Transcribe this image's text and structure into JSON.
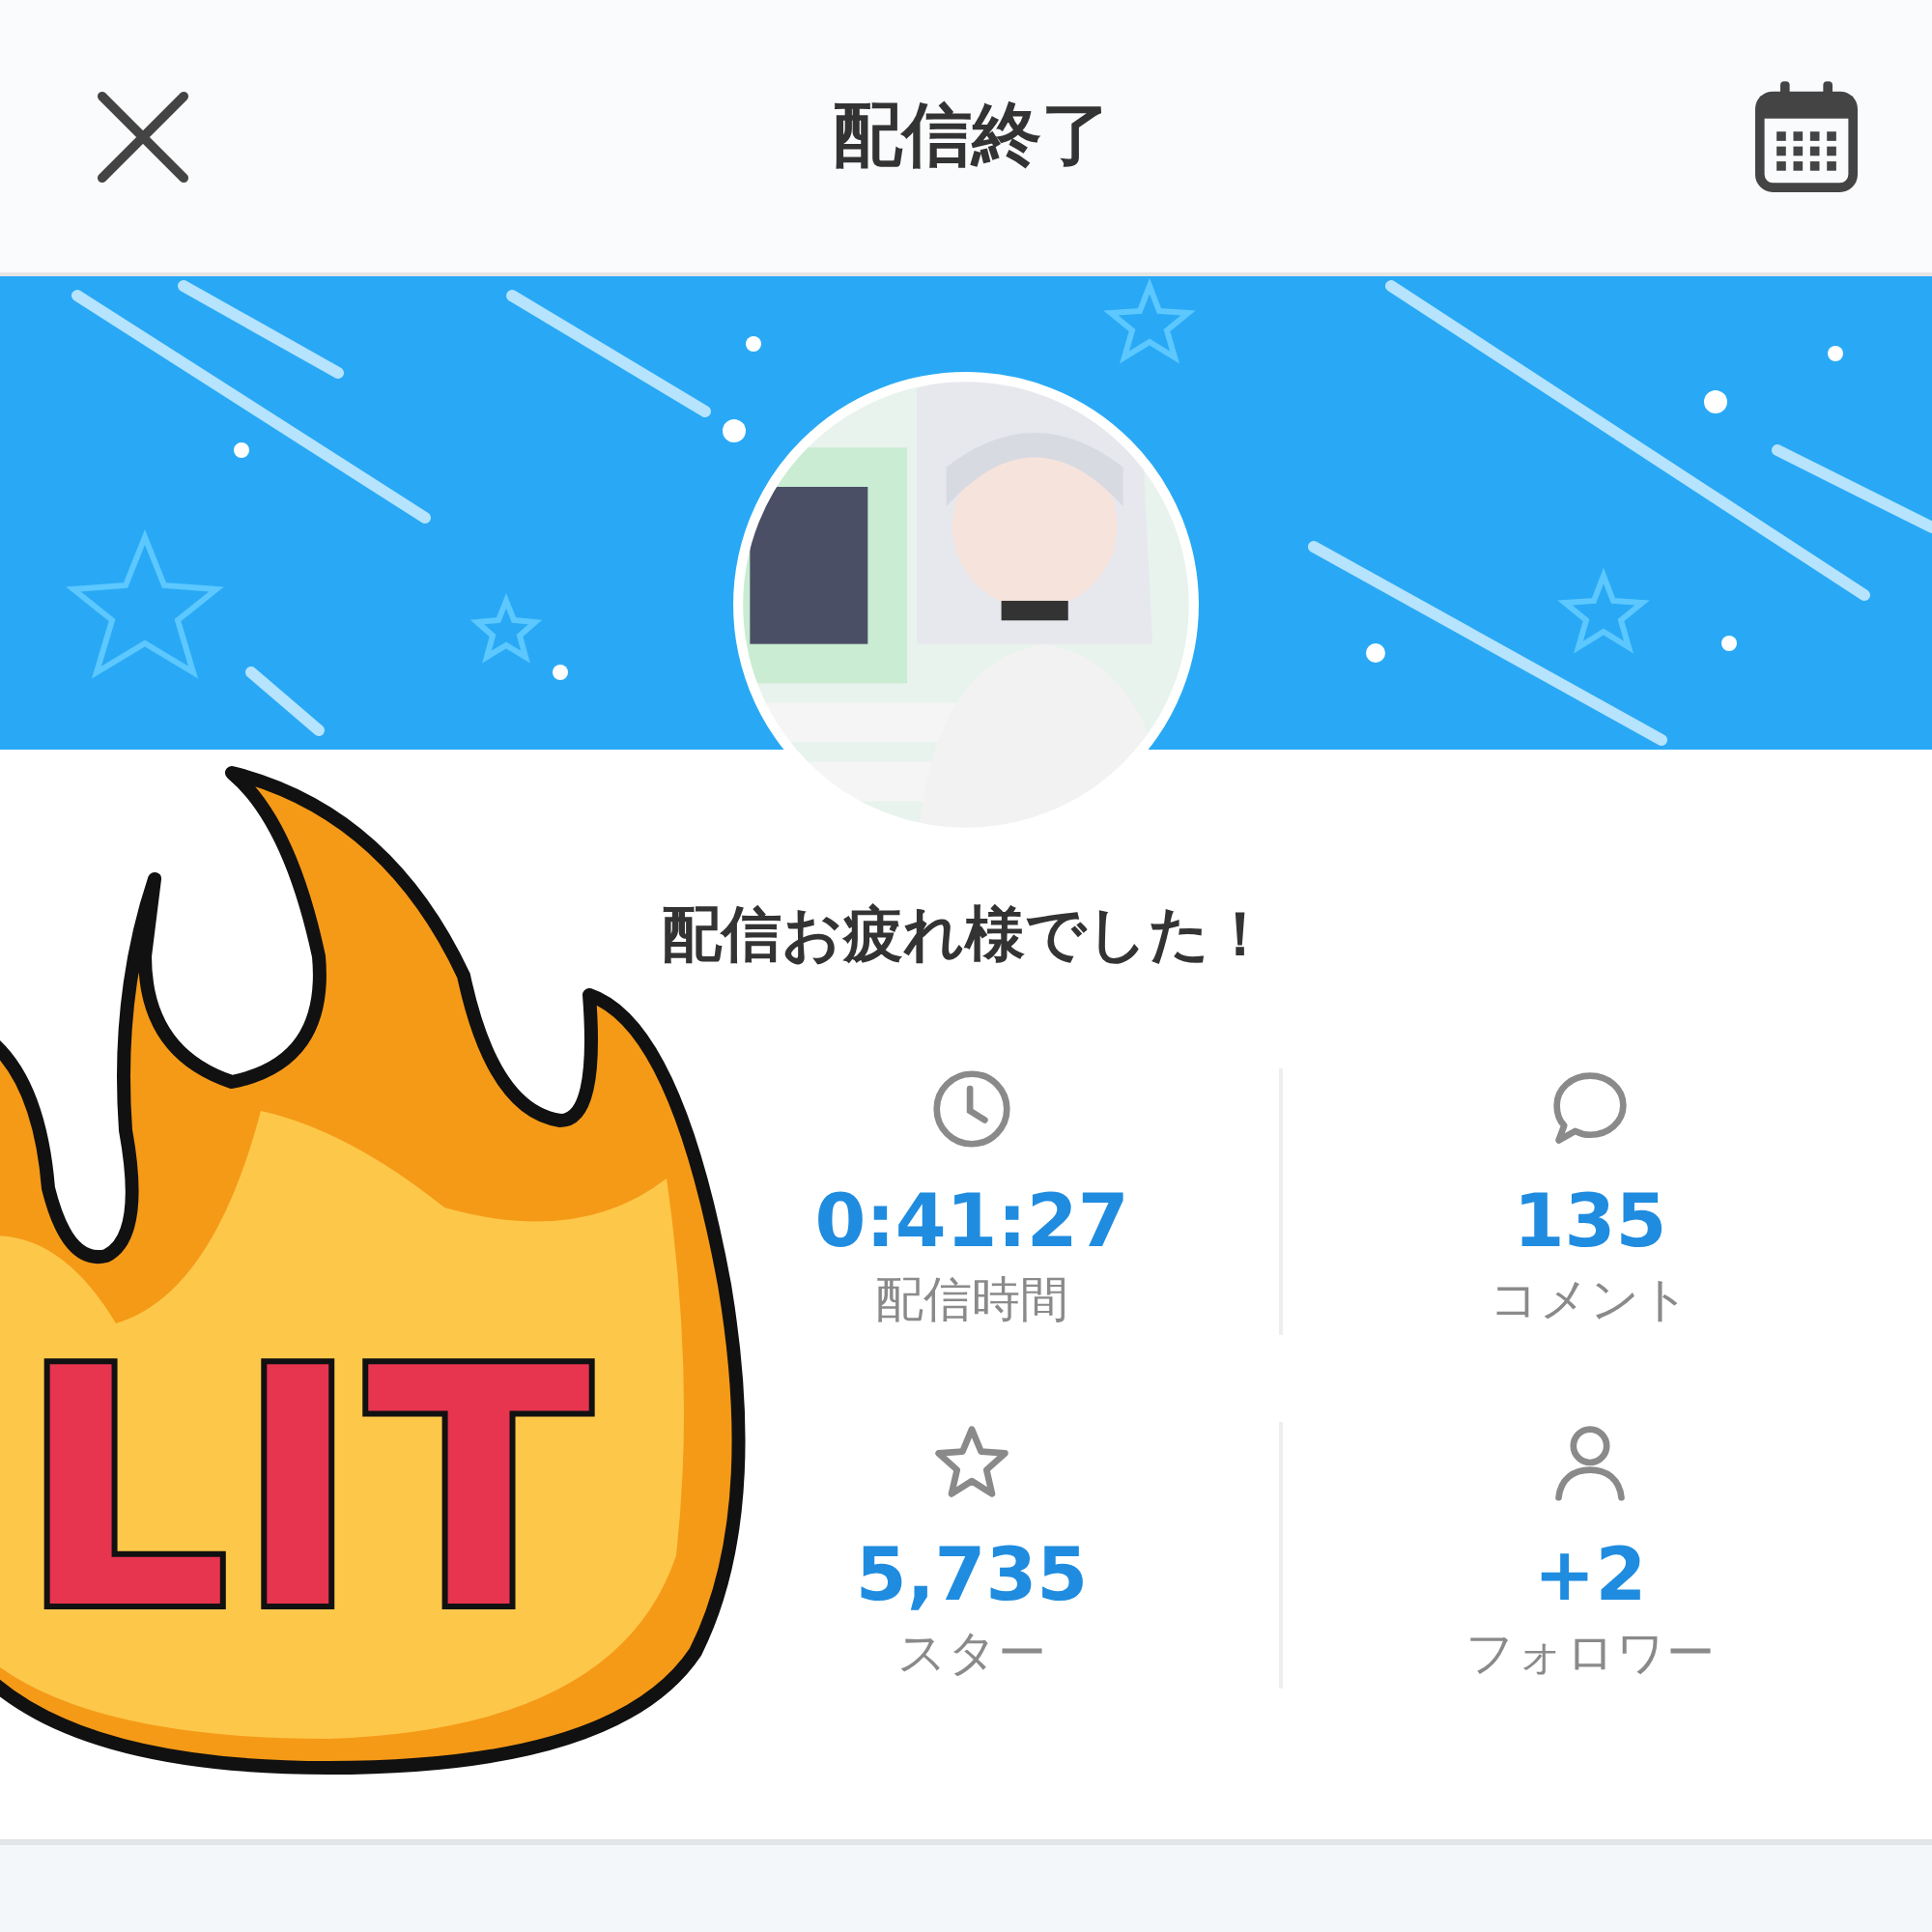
{
  "header": {
    "title": "配信終了"
  },
  "message": "配信お疲れ様でした！",
  "stats": [
    {
      "kind": "clock",
      "value": "0:41:27",
      "label": "配信時間"
    },
    {
      "kind": "comment",
      "value": "135",
      "label": "コメント"
    },
    {
      "kind": "star",
      "value": "5,735",
      "label": "スター"
    },
    {
      "kind": "person",
      "value": "+2",
      "label": "フォロワー"
    }
  ],
  "sticker": {
    "text": "LIT"
  }
}
